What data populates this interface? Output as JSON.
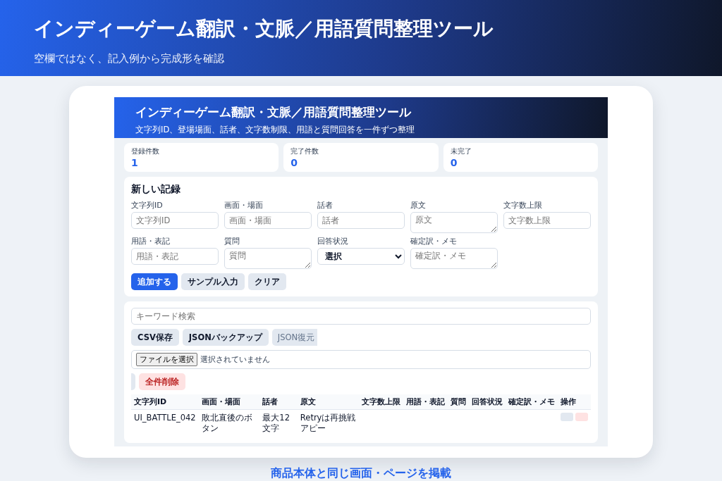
{
  "banner": {
    "title": "インディーゲーム翻訳・文脈／用語質問整理ツール",
    "subtitle": "空欄ではなく、記入例から完成形を確認"
  },
  "app": {
    "header": {
      "title": "インディーゲーム翻訳・文脈／用語質問整理ツール",
      "subtitle": "文字列ID、登場場面、話者、文字数制限、用語と質問回答を一件ずつ整理"
    },
    "stats": [
      {
        "label": "登録件数",
        "value": "1"
      },
      {
        "label": "完了件数",
        "value": "0"
      },
      {
        "label": "未完了",
        "value": "0"
      }
    ],
    "form": {
      "title": "新しい記録",
      "fields": [
        {
          "label": "文字列ID",
          "placeholder": "文字列ID",
          "kind": "input"
        },
        {
          "label": "画面・場面",
          "placeholder": "画面・場面",
          "kind": "input"
        },
        {
          "label": "話者",
          "placeholder": "話者",
          "kind": "input"
        },
        {
          "label": "原文",
          "placeholder": "原文",
          "kind": "textarea"
        },
        {
          "label": "文字数上限",
          "placeholder": "文字数上限",
          "kind": "input"
        },
        {
          "label": "用語・表記",
          "placeholder": "用語・表記",
          "kind": "input"
        },
        {
          "label": "質問",
          "placeholder": "質問",
          "kind": "textarea"
        },
        {
          "label": "回答状況",
          "value": "選択",
          "kind": "select"
        },
        {
          "label": "確定訳・メモ",
          "placeholder": "確定訳・メモ",
          "kind": "textarea"
        }
      ],
      "buttons": [
        {
          "label": "追加する",
          "kind": "primary"
        },
        {
          "label": "サンプル入力",
          "kind": "secondary"
        },
        {
          "label": "クリア",
          "kind": "secondary"
        }
      ]
    },
    "tools": {
      "search": {
        "placeholder": "キーワード検索"
      },
      "buttons": [
        {
          "label": "CSV保存",
          "kind": "secondary"
        },
        {
          "label": "JSONバックアップ",
          "kind": "secondary"
        },
        {
          "label": "JSON復元",
          "kind": "clipped"
        }
      ],
      "file": {
        "button": "ファイルを選択",
        "status": "選択されていません"
      },
      "danger_row": [
        {
          "kind": "sliver"
        },
        {
          "label": "全件削除",
          "kind": "danger"
        }
      ]
    },
    "table": {
      "columns": [
        "文字列ID",
        "画面・場面",
        "話者",
        "原文",
        "文字数上限",
        "用語・表記",
        "質問",
        "回答状況",
        "確定訳・メモ",
        "操作"
      ],
      "rows": [
        {
          "cells": [
            "UI_BATTLE_042",
            "敗北直後のボタン",
            "最大12文字",
            "Retryは再挑戦アピー",
            "",
            "",
            "",
            "",
            "",
            ""
          ],
          "actions": [
            {
              "kind": "secondary"
            },
            {
              "kind": "danger"
            }
          ]
        }
      ]
    }
  },
  "caption": "商品本体と同じ画面・ページを掲載"
}
